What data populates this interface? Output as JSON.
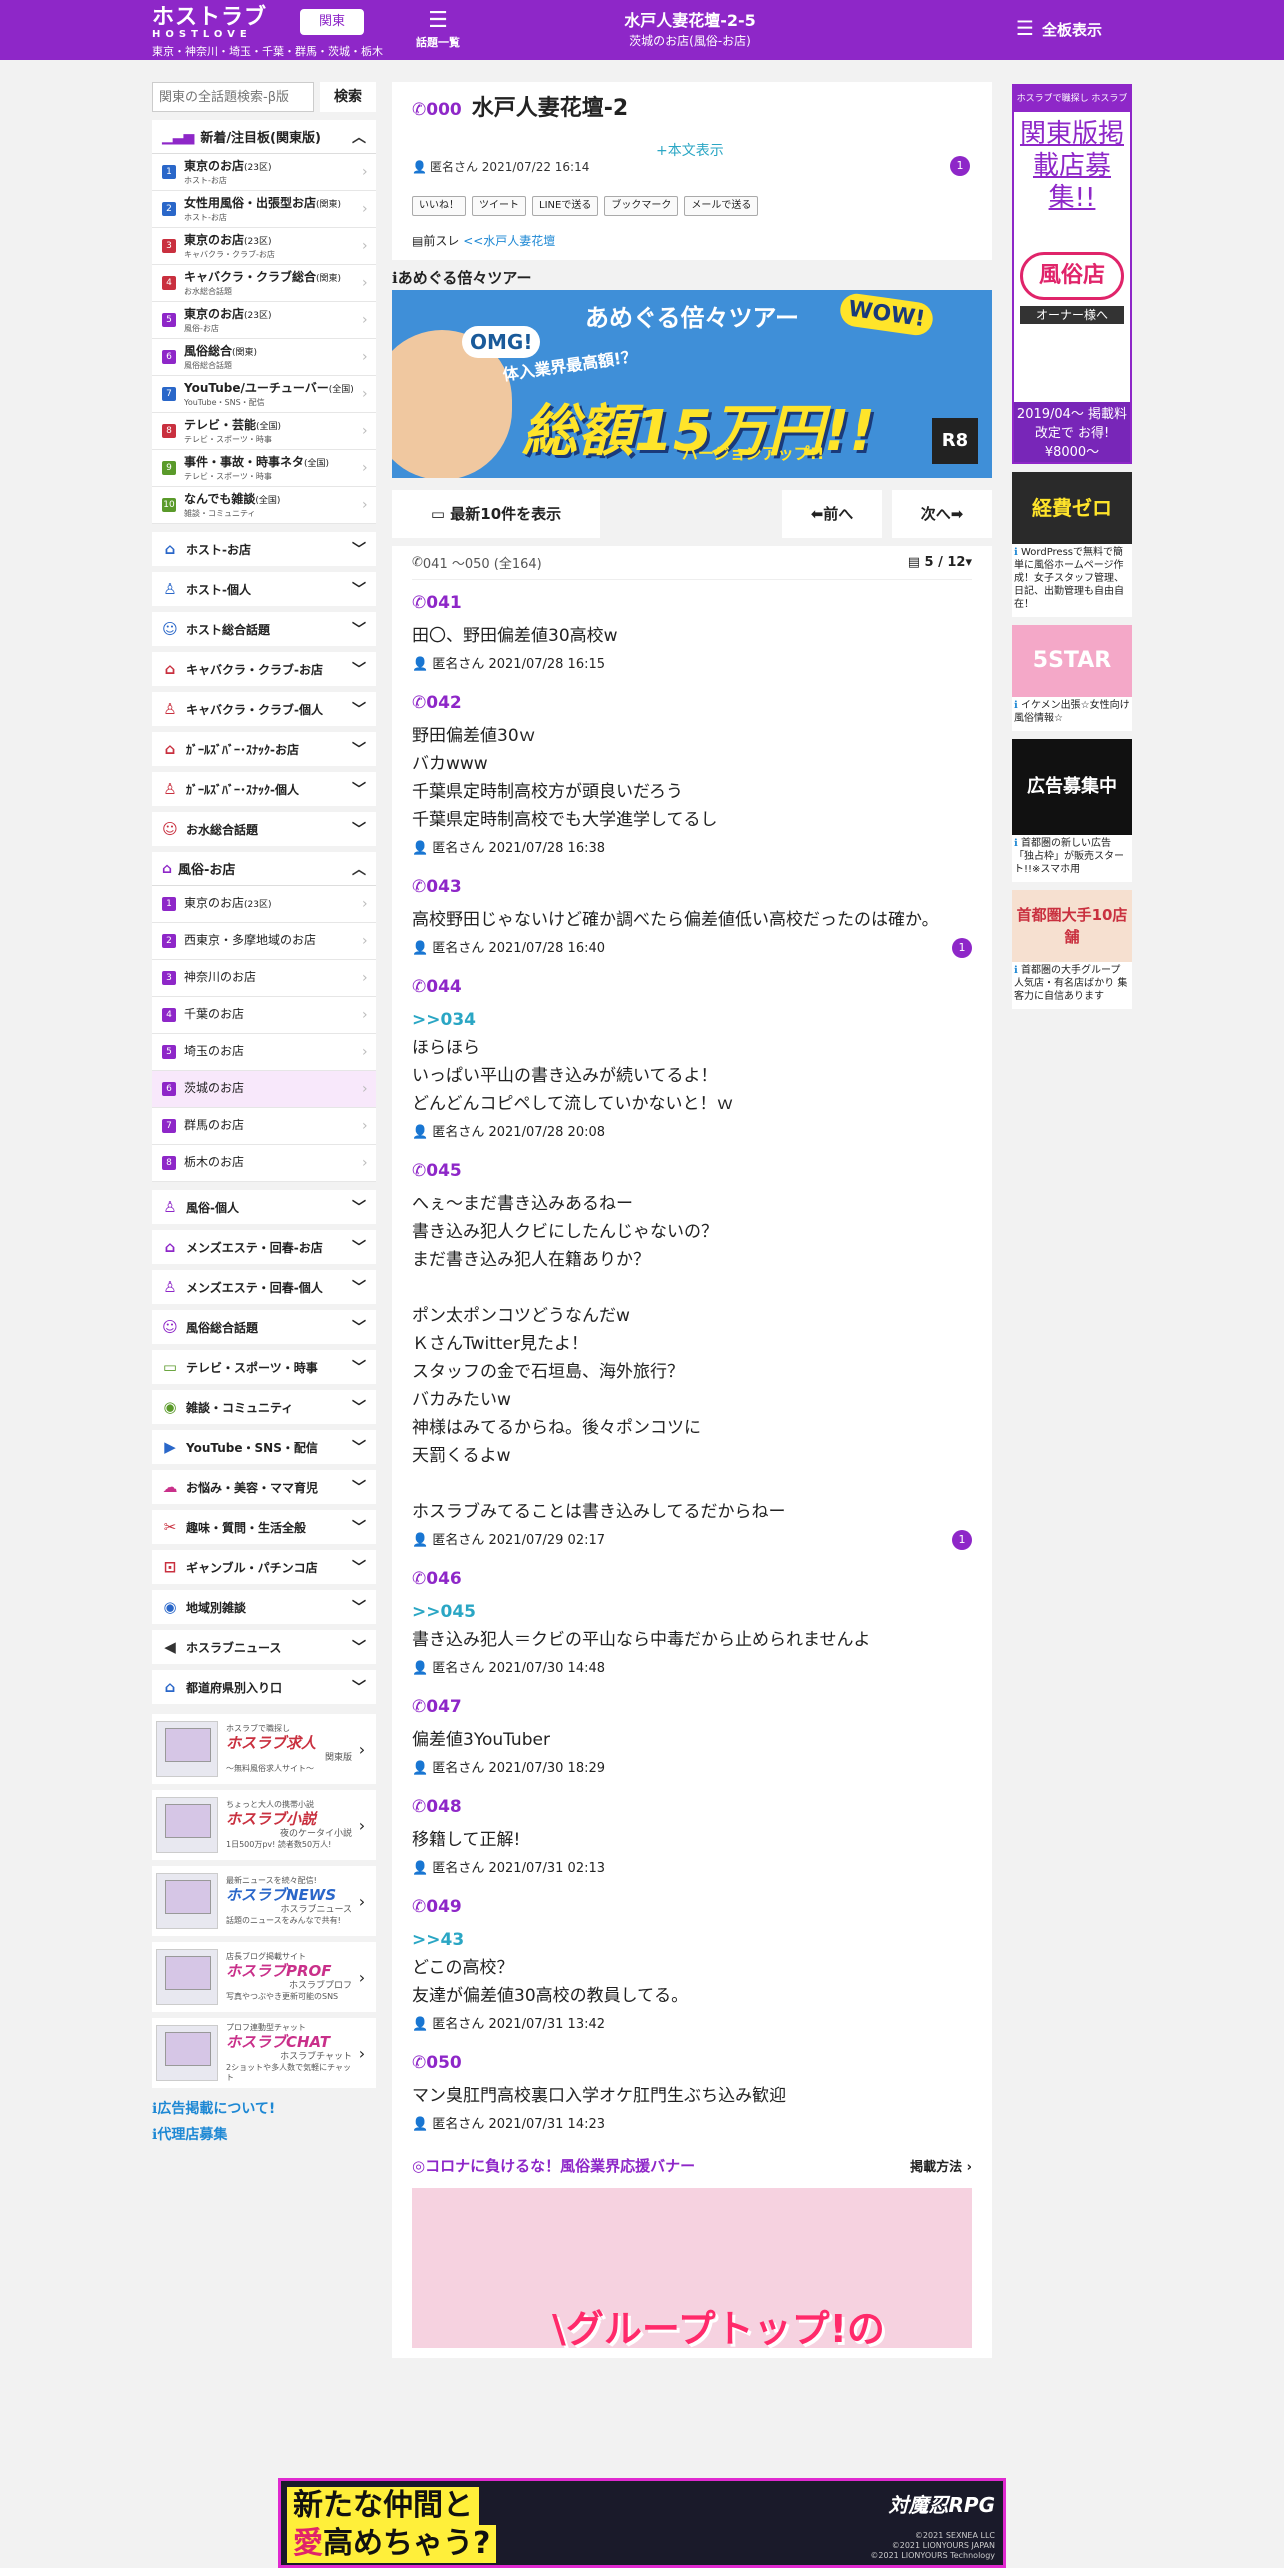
{
  "header": {
    "logo_top": "ホストラブ",
    "logo_bottom": "HOSTLOVE",
    "region_button": "関東",
    "region_sub": "東京・神奈川・埼玉・千葉・群馬・茨城・栃木",
    "topics_label": "話題一覧",
    "thread_title": "水戸人妻花壇-2-5",
    "thread_sub": "茨城のお店(風俗-お店)",
    "board_label": "全板表示",
    "brand_color": "#8e27c8"
  },
  "left": {
    "search_placeholder": "関東の全話題検索-β版",
    "search_button": "検索",
    "new_header": "新着/注目板(関東版)",
    "boards": [
      {
        "n": "1",
        "name": "東京のお店",
        "tag": "(23区)",
        "sub": "ホスト-お店",
        "color": "#2a67c9"
      },
      {
        "n": "2",
        "name": "女性用風俗・出張型お店",
        "tag": "(関東)",
        "sub": "ホスト-お店",
        "color": "#2a67c9"
      },
      {
        "n": "3",
        "name": "東京のお店",
        "tag": "(23区)",
        "sub": "キャバクラ・クラブ-お店",
        "color": "#c9303f"
      },
      {
        "n": "4",
        "name": "キャバクラ・クラブ総合",
        "tag": "(関東)",
        "sub": "お水総合話題",
        "color": "#c9303f"
      },
      {
        "n": "5",
        "name": "東京のお店",
        "tag": "(23区)",
        "sub": "風俗-お店",
        "color": "#8e27c8"
      },
      {
        "n": "6",
        "name": "風俗総合",
        "tag": "(関東)",
        "sub": "風俗総合話題",
        "color": "#8e27c8"
      },
      {
        "n": "7",
        "name": "YouTube/ユーチューバー",
        "tag": "(全国)",
        "sub": "YouTube・SNS・配信",
        "color": "#2a67c9"
      },
      {
        "n": "8",
        "name": "テレビ・芸能",
        "tag": "(全国)",
        "sub": "テレビ・スポーツ・時事",
        "color": "#c9303f"
      },
      {
        "n": "9",
        "name": "事件・事故・時事ネタ",
        "tag": "(全国)",
        "sub": "テレビ・スポーツ・時事",
        "color": "#5a9a2a"
      },
      {
        "n": "10",
        "name": "なんでも雑談",
        "tag": "(全国)",
        "sub": "雑談・コミュニティ",
        "color": "#5a9a2a"
      }
    ],
    "cats_a": [
      {
        "label": "ホスト-お店",
        "icon": "⌂",
        "color": "#2a67c9"
      },
      {
        "label": "ホスト-個人",
        "icon": "♙",
        "color": "#2a67c9"
      },
      {
        "label": "ホスト総合話題",
        "icon": "☺",
        "color": "#2a67c9"
      },
      {
        "label": "キャバクラ・クラブ-お店",
        "icon": "⌂",
        "color": "#c9303f"
      },
      {
        "label": "キャバクラ・クラブ-個人",
        "icon": "♙",
        "color": "#c9303f"
      },
      {
        "label": "ｶﾞｰﾙｽﾞﾊﾞｰ･ｽﾅｯｸ-お店",
        "icon": "⌂",
        "color": "#c9303f"
      },
      {
        "label": "ｶﾞｰﾙｽﾞﾊﾞｰ･ｽﾅｯｸ-個人",
        "icon": "♙",
        "color": "#c9303f"
      },
      {
        "label": "お水総合話題",
        "icon": "☺",
        "color": "#c9303f"
      }
    ],
    "fuzoku_header": "風俗-お店",
    "fuzoku_items": [
      {
        "n": "1",
        "name": "東京のお店",
        "tag": "(23区)"
      },
      {
        "n": "2",
        "name": "西東京・多摩地域のお店",
        "tag": ""
      },
      {
        "n": "3",
        "name": "神奈川のお店",
        "tag": ""
      },
      {
        "n": "4",
        "name": "千葉のお店",
        "tag": ""
      },
      {
        "n": "5",
        "name": "埼玉のお店",
        "tag": ""
      },
      {
        "n": "6",
        "name": "茨城のお店",
        "tag": ""
      },
      {
        "n": "7",
        "name": "群馬のお店",
        "tag": ""
      },
      {
        "n": "8",
        "name": "栃木のお店",
        "tag": ""
      }
    ],
    "cats_b": [
      {
        "label": "風俗-個人",
        "icon": "♙",
        "color": "#8e27c8"
      },
      {
        "label": "メンズエステ・回春-お店",
        "icon": "⌂",
        "color": "#8e27c8"
      },
      {
        "label": "メンズエステ・回春-個人",
        "icon": "♙",
        "color": "#8e27c8"
      },
      {
        "label": "風俗総合話題",
        "icon": "☺",
        "color": "#8e27c8"
      },
      {
        "label": "テレビ・スポーツ・時事",
        "icon": "▭",
        "color": "#5a9a2a"
      },
      {
        "label": "雑談・コミュニティ",
        "icon": "◉",
        "color": "#5a9a2a"
      },
      {
        "label": "YouTube・SNS・配信",
        "icon": "▶",
        "color": "#2a67c9"
      },
      {
        "label": "お悩み・美容・ママ育児",
        "icon": "☁",
        "color": "#c9308a"
      },
      {
        "label": "趣味・質問・生活全般",
        "icon": "✂",
        "color": "#c9303f"
      },
      {
        "label": "ギャンブル・パチンコ店",
        "icon": "⊡",
        "color": "#c9303f"
      },
      {
        "label": "地域別雑談",
        "icon": "◉",
        "color": "#2a67c9"
      },
      {
        "label": "ホスラブニュース",
        "icon": "◀",
        "color": "#333333"
      },
      {
        "label": "都道府県別入り口",
        "icon": "⌂",
        "color": "#2a67c9"
      }
    ],
    "promos": [
      {
        "top": "ホスラブで職探し",
        "big": "ホスラブ求人",
        "sub": "関東版",
        "sub2": "〜無料風俗求人サイト〜"
      },
      {
        "top": "ちょっと大人の携帯小説",
        "big": "ホスラブ小説",
        "sub": "夜のケータイ小説",
        "sub2": "1日500万pv! 読者数50万人!"
      },
      {
        "top": "最新ニュースを続々配信!",
        "big": "ホスラブNEWS",
        "sub": "ホスラブニュース",
        "sub2": "話題のニュースをみんなで共有!"
      },
      {
        "top": "店長ブログ掲載サイト",
        "big": "ホスラブPROF",
        "sub": "ホスラブプロフ",
        "sub2": "写真やつぶやき更新可能のSNS"
      },
      {
        "top": "プロフ連動型チャット",
        "big": "ホスラブCHAT",
        "sub": "ホスラブチャット",
        "sub2": "2ショットや多人数で気軽にチャット"
      }
    ],
    "links": [
      "広告掲載について!",
      "代理店募集"
    ]
  },
  "op": {
    "num": "000",
    "title": "水戸人妻花壇-2",
    "show_body": "+本文表示",
    "author": "匿名さん",
    "date": "2021/07/22 16:14",
    "badge": "1",
    "shares": [
      "いいね！",
      "ツイート",
      "LINEで送る",
      "ブックマーク",
      "メールで送る"
    ],
    "prev_label": "前スレ",
    "prev_link": "<<水戸人妻花壇"
  },
  "ad": {
    "title": "あめぐる倍々ツアー",
    "banner_top": "あめぐる倍々ツアー",
    "banner_mid": "体入業界最高額!？",
    "banner_big": "総額15万円!!",
    "banner_ver": "バージョンアップ!!",
    "omg": "OMG!",
    "wow": "WOW!"
  },
  "nav": {
    "latest": "最新10件を表示",
    "prev": "前へ",
    "next": "次へ"
  },
  "list": {
    "range": "041 ～050 (全164)",
    "page": "5 / 12"
  },
  "posts": [
    {
      "num": "041",
      "anchor": "",
      "body": "田〇、野田偏差値30高校w",
      "author": "匿名さん",
      "date": "2021/07/28 16:15",
      "badge": ""
    },
    {
      "num": "042",
      "anchor": "",
      "body": "野田偏差値30ｗ\nバカwww\n千葉県定時制高校方が頭良いだろう\n千葉県定時制高校でも大学進学してるし",
      "author": "匿名さん",
      "date": "2021/07/28 16:38",
      "badge": ""
    },
    {
      "num": "043",
      "anchor": "",
      "body": "高校野田じゃないけど確か調べたら偏差値低い高校だったのは確か。",
      "author": "匿名さん",
      "date": "2021/07/28 16:40",
      "badge": "1"
    },
    {
      "num": "044",
      "anchor": ">>034",
      "body": "ほらほら\nいっぱい平山の書き込みが続いてるよ！\nどんどんコピペして流していかないと！ｗ",
      "author": "匿名さん",
      "date": "2021/07/28 20:08",
      "badge": ""
    },
    {
      "num": "045",
      "anchor": "",
      "body": "へぇ〜まだ書き込みあるねー\n書き込み犯人クビにしたんじゃないの？\nまだ書き込み犯人在籍ありか？\n\nポン太ポンコツどうなんだw\nＫさんTwitter見たよ！\nスタッフの金で石垣島、海外旅行？\nバカみたいw\n神様はみてるからね。後々ポンコツに\n天罰くるよw\n\nホスラブみてることは書き込みしてるだからねー",
      "author": "匿名さん",
      "date": "2021/07/29 02:17",
      "badge": "1"
    },
    {
      "num": "046",
      "anchor": ">>045",
      "body": "書き込み犯人＝クビの平山なら中毒だから止められませんよ",
      "author": "匿名さん",
      "date": "2021/07/30 14:48",
      "badge": ""
    },
    {
      "num": "047",
      "anchor": "",
      "body": "偏差値3YouTuber",
      "author": "匿名さん",
      "date": "2021/07/30 18:29",
      "badge": ""
    },
    {
      "num": "048",
      "anchor": "",
      "body": "移籍して正解!",
      "author": "匿名さん",
      "date": "2021/07/31 02:13",
      "badge": ""
    },
    {
      "num": "049",
      "anchor": ">>43",
      "body": "どこの高校？\n友達が偏差値30高校の教員してる。",
      "author": "匿名さん",
      "date": "2021/07/31 13:42",
      "badge": ""
    },
    {
      "num": "050",
      "anchor": "",
      "body": "マン臭肛門高校裏口入学オケ肛門生ぶち込み歓迎",
      "author": "匿名さん",
      "date": "2021/07/31 14:23",
      "badge": ""
    }
  ],
  "corona": {
    "title": "◎コロナに負けるな！風俗業界応援バナー",
    "link": "掲載方法",
    "banner_text": "\\グループトップ!の"
  },
  "right": {
    "ad1_top": "ホスラブで職探し ホスラブ求人",
    "ad1_main": "関東版掲載店募集!!",
    "ad1_pill": "風俗店",
    "ad1_owner": "オーナー様へ",
    "ad1_bottom": "2019/04〜 掲載料改定で お得!¥8000〜",
    "ad2_caption": "WordPressで無料で簡単に風俗ホームページ作成！女子スタッフ管理、日記、出勤管理も自由自在！",
    "ad3_caption": "イケメン出張☆女性向け風俗情報☆",
    "ad4_caption": "首都圏の新しい広告「独占枠」が販売スタート!!※スマホ用",
    "ad5_caption": "首都圏の大手グループ 人気店・有名店ばかり 集客力に自信あります",
    "ad2_label": "経費ゼロ",
    "ad3_label": "5STAR",
    "ad4_label": "広告募集中",
    "ad5_label": "首都圏大手10店舗"
  },
  "footer_ad": {
    "line1": "新たな仲間と",
    "line2a": "愛",
    "line2b": "高めちゃう?",
    "logo": "対魔忍RPG",
    "copy": "©2021 SEXNEA LLC\n©2021 LIONYOURS JAPAN\n©2021 LIONYOURS Technology"
  }
}
